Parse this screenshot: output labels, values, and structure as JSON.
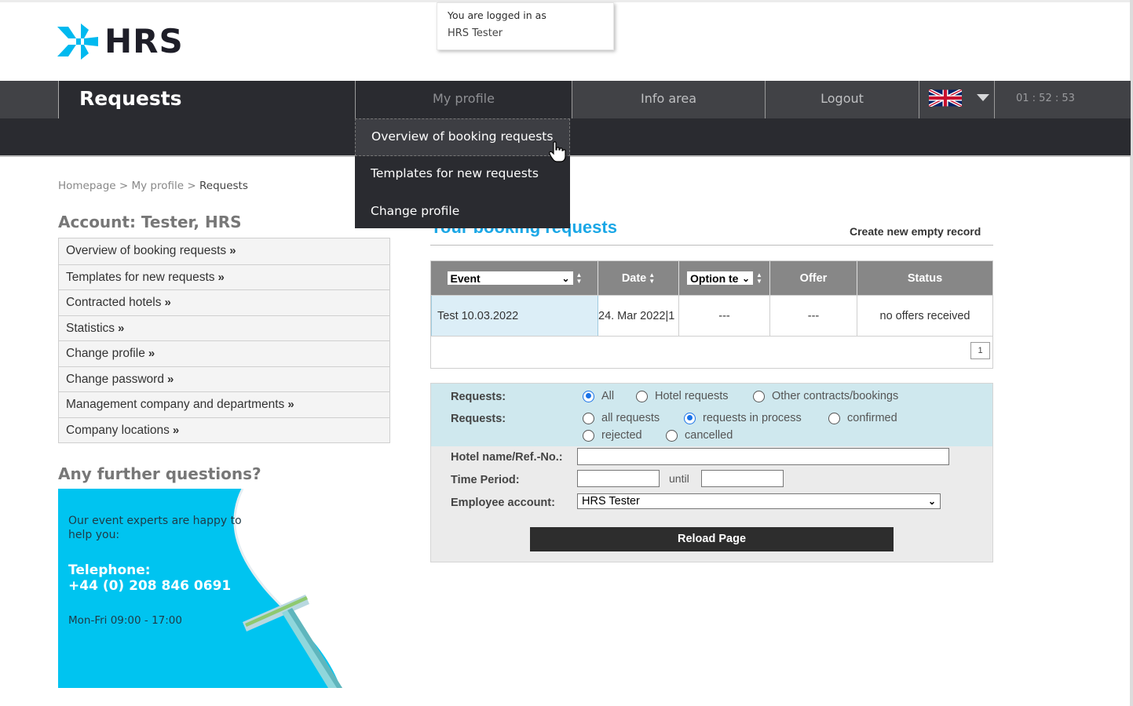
{
  "brand": {
    "name": "HRS",
    "accent": "#00c4f0",
    "dark": "#2a2b30"
  },
  "login": {
    "line1": "You are logged in as",
    "user": "HRS Tester"
  },
  "nav": {
    "section_title": "Requests",
    "items": [
      {
        "label": "My profile"
      },
      {
        "label": "Info area"
      },
      {
        "label": "Logout"
      }
    ],
    "language_icon": "uk-flag-icon",
    "clock": "01 : 52 : 53"
  },
  "dropdown": {
    "items": [
      {
        "label": "Overview of booking requests"
      },
      {
        "label": "Templates for new requests"
      },
      {
        "label": "Change profile"
      }
    ]
  },
  "breadcrumb": {
    "home": "Homepage",
    "sep1": " > ",
    "profile": "My profile",
    "sep2": " > ",
    "current": "Requests"
  },
  "sidebar": {
    "account_title": "Account: Tester, HRS",
    "items": [
      {
        "label": "Overview of booking requests"
      },
      {
        "label": "Templates for new requests"
      },
      {
        "label": "Contracted hotels"
      },
      {
        "label": "Statistics"
      },
      {
        "label": "Change profile"
      },
      {
        "label": "Change password"
      },
      {
        "label": "Management company and departments"
      },
      {
        "label": "Company locations"
      }
    ],
    "suffix": "»"
  },
  "promo": {
    "title": "Any further questions?",
    "intro": "Our event experts are happy to help you:",
    "tel_label": "Telephone:",
    "tel_number": "+44 (0) 208 846 0691",
    "hours": "Mon-Fri 09:00 - 17:00"
  },
  "main": {
    "title": "Your booking requests",
    "create_link": "Create new empty record",
    "table": {
      "headers": {
        "event_select": "Event",
        "date": "Date",
        "option_select": "Option te",
        "offer": "Offer",
        "status": "Status"
      },
      "rows": [
        {
          "event": "Test 10.03.2022",
          "date": "24. Mar 2022|1",
          "option": "---",
          "offer": "---",
          "status": "no offers received"
        }
      ],
      "page": "1"
    },
    "filter": {
      "requests_label_1": "Requests:",
      "radios_1": [
        {
          "label": "All",
          "checked": true
        },
        {
          "label": "Hotel requests",
          "checked": false
        },
        {
          "label": "Other contracts/bookings",
          "checked": false
        }
      ],
      "requests_label_2": "Requests:",
      "radios_2": [
        {
          "label": "all requests",
          "checked": false
        },
        {
          "label": "requests in process",
          "checked": true
        },
        {
          "label": "confirmed",
          "checked": false
        },
        {
          "label": "rejected",
          "checked": false
        },
        {
          "label": "cancelled",
          "checked": false
        }
      ],
      "hotel_label": "Hotel name/Ref.-No.:",
      "hotel_value": "",
      "period_label": "Time Period:",
      "period_from": "",
      "until_label": "until",
      "period_to": "",
      "employee_label": "Employee account:",
      "employee_value": "HRS Tester",
      "reload_label": "Reload Page"
    }
  }
}
